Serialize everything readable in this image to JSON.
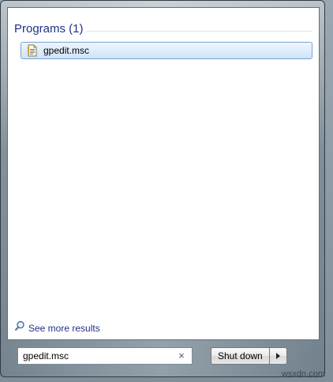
{
  "results": {
    "section_header": "Programs (1)",
    "items": [
      {
        "label": "gpedit.msc",
        "icon": "msc-document-icon"
      }
    ]
  },
  "see_more": {
    "label": "See more results",
    "icon": "search-magnifier-icon"
  },
  "search": {
    "value": "gpedit.msc",
    "clear_glyph": "×"
  },
  "shutdown": {
    "label": "Shut down",
    "arrow_icon": "chevron-right-icon"
  },
  "watermark": {
    "text": "wsxdn.com"
  },
  "colors": {
    "header_text": "#1e3287",
    "selection_border": "#7da2ce",
    "selection_fill": "#dcebfc"
  }
}
